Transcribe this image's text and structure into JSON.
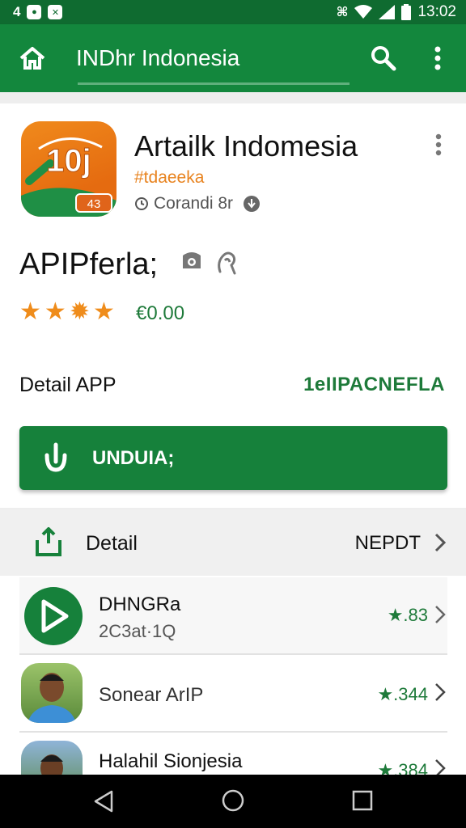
{
  "status_bar": {
    "left_number": "4",
    "time": "13:02",
    "icons": [
      "notification-icon",
      "image-icon",
      "nfc-icon",
      "wifi-icon",
      "signal-icon",
      "battery-icon"
    ]
  },
  "app_bar": {
    "title": "INDhr Indonesia",
    "icons": [
      "home-icon",
      "search-icon",
      "more-vert-icon"
    ]
  },
  "app": {
    "name": "Artailk Indomesia",
    "tag": "#tdaeeka",
    "developer": "Corandi 8r",
    "icon_text": "10j",
    "icon_badge": "43"
  },
  "price_section": {
    "title": "APIPferla;",
    "stars": 5,
    "rating": "€0.00"
  },
  "detail_header": {
    "label": "Detail APP",
    "link": "1eIIPACNEFLA"
  },
  "download_button": {
    "label": "UNDUIA;"
  },
  "detail_row": {
    "label": "Detail",
    "action": "NEPDT"
  },
  "list": [
    {
      "title": "DHNGRa",
      "subtitle": "2C3at·1Q",
      "rating": "★.83"
    },
    {
      "title": "Sonear ArIP",
      "subtitle": "",
      "rating": "★.344"
    },
    {
      "title": "Halahil Sionjesia",
      "subtitle": "",
      "rating": "★.384"
    }
  ],
  "colors": {
    "primary_green": "#13873d",
    "status_green": "#0f6b30",
    "accent_orange": "#ef8c1b",
    "text_green": "#1e7a3a"
  },
  "nav_bar": {
    "icons": [
      "back-icon",
      "home-circle-icon",
      "recents-icon"
    ]
  }
}
